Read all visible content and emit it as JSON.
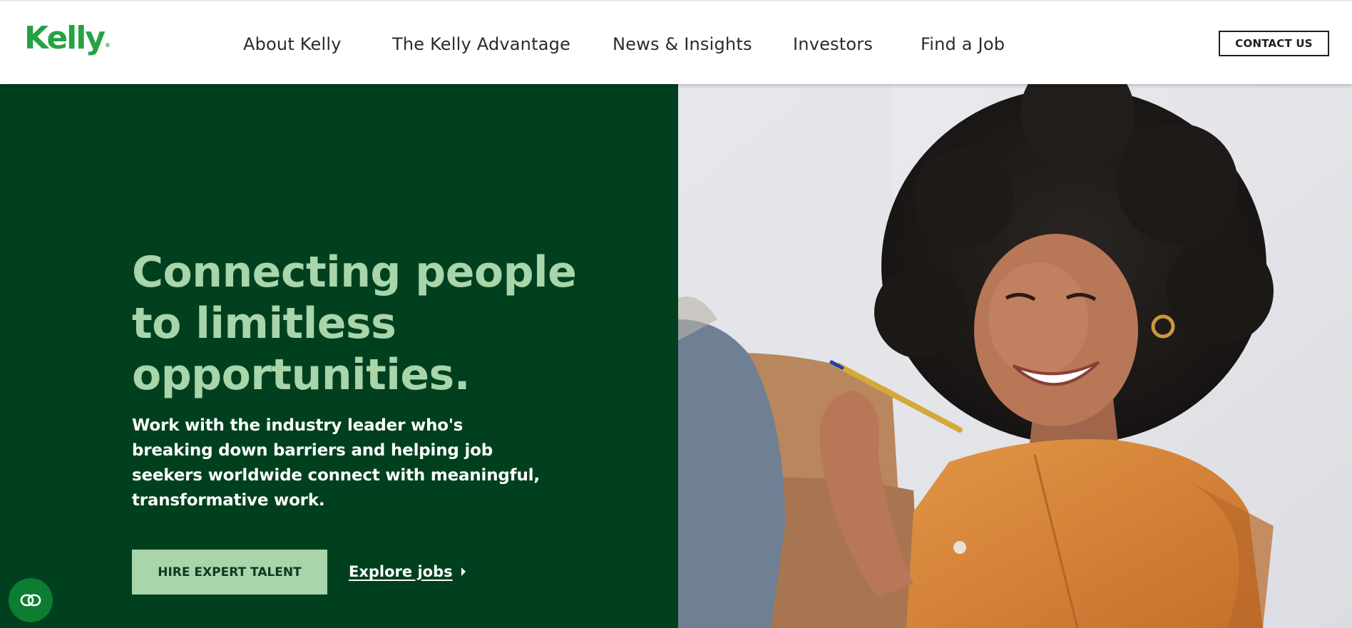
{
  "header": {
    "logo_text": "Kelly",
    "logo_mark": "®",
    "nav": [
      {
        "label": "About Kelly"
      },
      {
        "label": "The Kelly Advantage"
      },
      {
        "label": "News & Insights"
      },
      {
        "label": "Investors"
      },
      {
        "label": "Find a Job"
      }
    ],
    "contact_label": "CONTACT US"
  },
  "hero": {
    "headline": "Connecting people to limitless opportunities.",
    "subtext": "Work with the industry leader who's breaking down barriers and helping job seekers worldwide connect with meaningful, transformative work.",
    "primary_button": "HIRE EXPERT TALENT",
    "secondary_link": "Explore jobs",
    "photo_icon": "smiling-woman-photo"
  },
  "accessibility": {
    "icon": "accessibility-toggle-icon"
  },
  "colors": {
    "brand_green": "#25a244",
    "hero_dark_green": "#00401f",
    "hero_light_green": "#a8d5a9",
    "accent_orange": "#d9833a"
  }
}
